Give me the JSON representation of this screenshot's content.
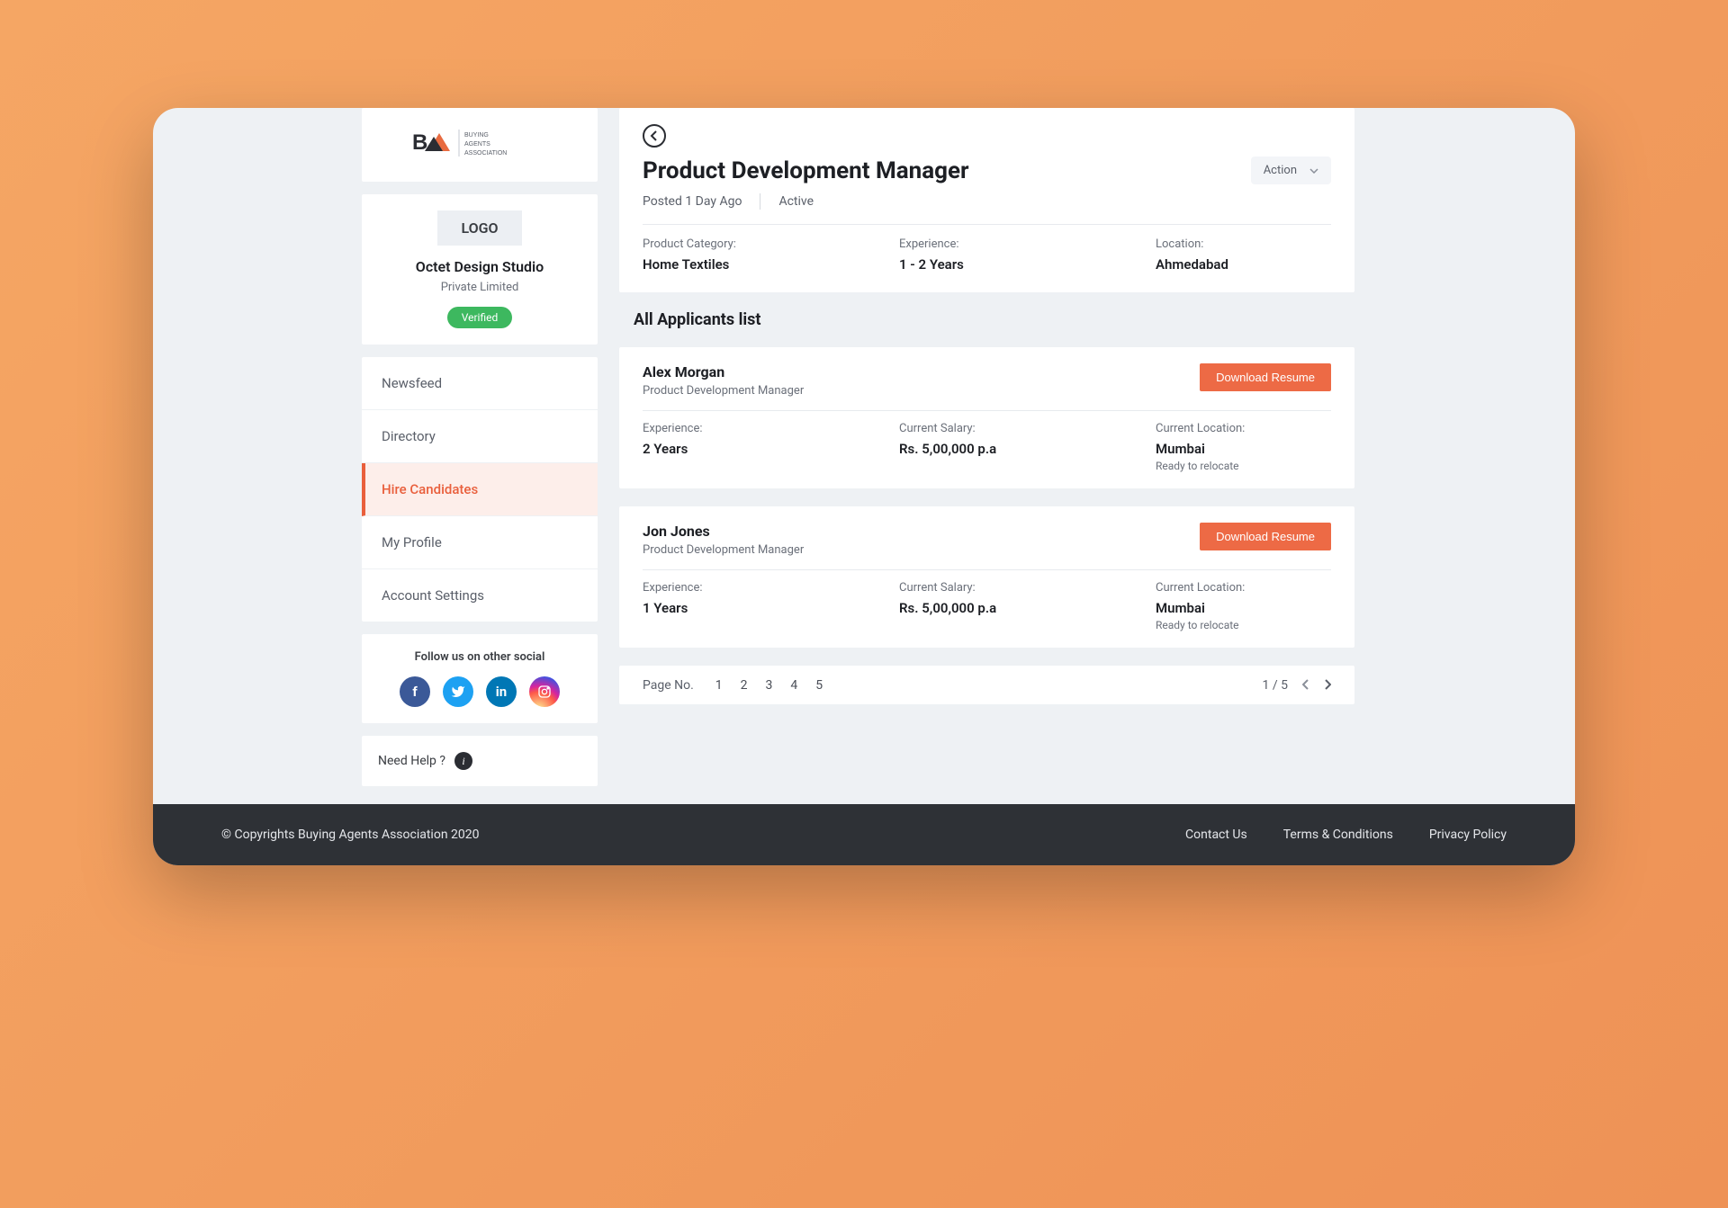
{
  "sidebar": {
    "logo_text_1": "BUYING",
    "logo_text_2": "AGENTS",
    "logo_text_3": "ASSOCIATION",
    "logo_placeholder": "LOGO",
    "company_name": "Octet Design Studio",
    "company_type": "Private Limited",
    "verified_label": "Verified",
    "nav": [
      {
        "label": "Newsfeed"
      },
      {
        "label": "Directory"
      },
      {
        "label": "Hire Candidates"
      },
      {
        "label": "My Profile"
      },
      {
        "label": "Account Settings"
      }
    ],
    "social_title": "Follow us on other social",
    "help_label": "Need Help ?"
  },
  "main": {
    "job_title": "Product Development Manager",
    "posted": "Posted 1 Day Ago",
    "status": "Active",
    "action_label": "Action",
    "details": {
      "category_label": "Product Category:",
      "category_value": "Home Textiles",
      "experience_label": "Experience:",
      "experience_value": "1 - 2 Years",
      "location_label": "Location:",
      "location_value": "Ahmedabad"
    },
    "applicants_title": "All Applicants list",
    "download_label": "Download Resume",
    "applicants": [
      {
        "name": "Alex Morgan",
        "role": "Product Development Manager",
        "exp_label": "Experience:",
        "exp_value": "2 Years",
        "salary_label": "Current Salary:",
        "salary_value": "Rs. 5,00,000 p.a",
        "loc_label": "Current Location:",
        "loc_value": "Mumbai",
        "loc_note": "Ready to relocate"
      },
      {
        "name": "Jon Jones",
        "role": "Product Development Manager",
        "exp_label": "Experience:",
        "exp_value": "1 Years",
        "salary_label": "Current Salary:",
        "salary_value": "Rs. 5,00,000 p.a",
        "loc_label": "Current Location:",
        "loc_value": "Mumbai",
        "loc_note": "Ready to relocate"
      }
    ],
    "pagination": {
      "page_label": "Page No.",
      "pages": [
        "1",
        "2",
        "3",
        "4",
        "5"
      ],
      "current": "1 / 5"
    }
  },
  "footer": {
    "copyright": "© Copyrights Buying Agents Association 2020",
    "links": [
      "Contact Us",
      "Terms & Conditions",
      "Privacy Policy"
    ]
  }
}
